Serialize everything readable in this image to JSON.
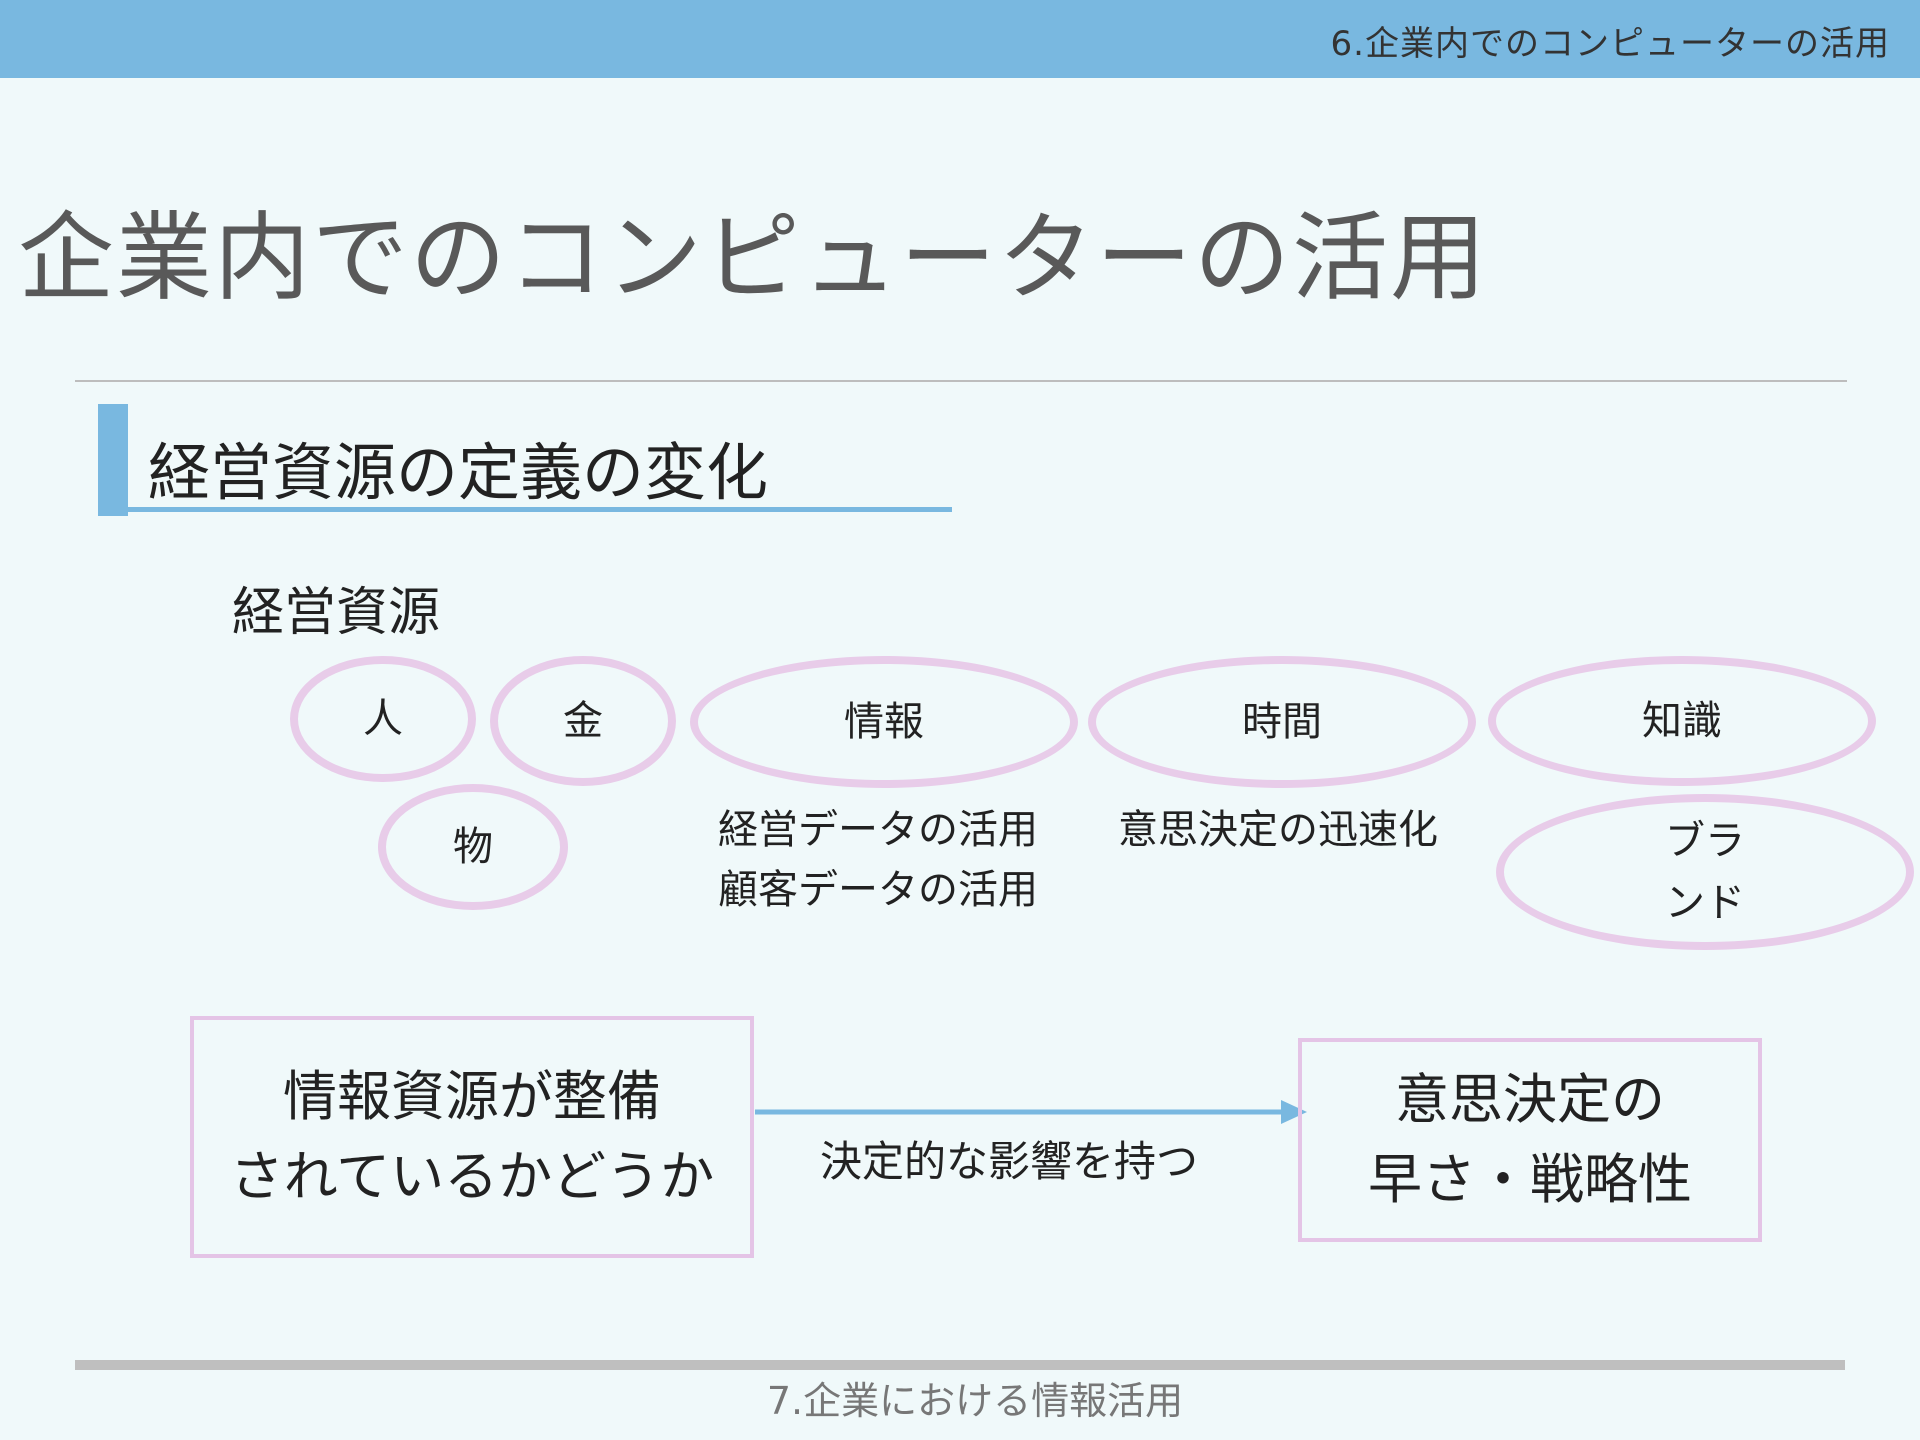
{
  "header": {
    "title": "6.企業内でのコンピューターの活用"
  },
  "slide": {
    "title": "企業内でのコンピューターの活用"
  },
  "section": {
    "heading": "経営資源の定義の変化"
  },
  "resources": {
    "label": "経営資源",
    "items": {
      "people": "人",
      "money": "金",
      "things": "物",
      "information": "情報",
      "time": "時間",
      "knowledge": "知識",
      "brand_line1": "ブラ",
      "brand_line2": "ンド"
    },
    "notes": {
      "information_line1": "経営データの活用",
      "information_line2": "顧客データの活用",
      "time": "意思決定の迅速化"
    }
  },
  "flow": {
    "left_line1": "情報資源が整備",
    "left_line2": "されているかどうか",
    "arrow_label": "決定的な影響を持つ",
    "right_line1": "意思決定の",
    "right_line2": "早さ・戦略性"
  },
  "footer": {
    "text": "7.企業における情報活用"
  },
  "colors": {
    "accent": "#79b8e0",
    "ellipse_border": "#e8cce9",
    "box_border": "#e4c4e6",
    "background": "#f0f9fa"
  }
}
